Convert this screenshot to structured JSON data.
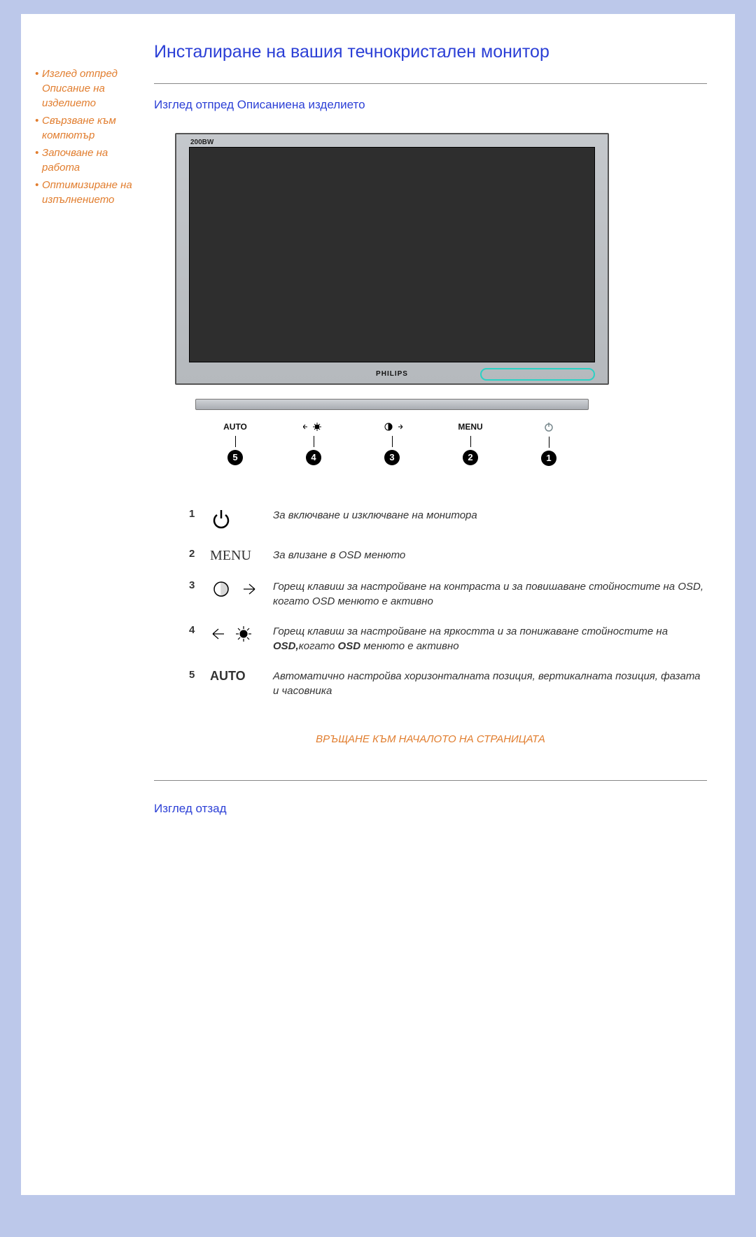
{
  "sidebar": {
    "items": [
      {
        "label": "Изглед отпред Описание на изделието"
      },
      {
        "label": "Свързване към компютър"
      },
      {
        "label": "Започване на работа"
      },
      {
        "label": "Оптимизиране на изпълнението"
      }
    ]
  },
  "page_title": "Инсталиране на вашия течнокристален   монитор",
  "front_heading": "Изглед отпред  Описаниена изделието",
  "monitor": {
    "model": "200BW",
    "brand": "PHILIPS"
  },
  "controls_strip": {
    "c5": "AUTO",
    "c2": "MENU",
    "badges": {
      "b1": "1",
      "b2": "2",
      "b3": "3",
      "b4": "4",
      "b5": "5"
    }
  },
  "legend": {
    "rows": [
      {
        "num": "1",
        "icon": "power",
        "text": "За включване и изключване на монитора"
      },
      {
        "num": "2",
        "icon": "menu",
        "text": "За влизане в OSD менюто"
      },
      {
        "num": "3",
        "icon": "contrast",
        "text": "Горещ клавиш за настройване на контраста и за повишаване стойностите на OSD, когато OSD менюто е активно"
      },
      {
        "num": "4",
        "icon": "brightness",
        "text_pre": "Горещ клавиш за настройване на яркостта и за понижаване стойностите на ",
        "text_b1": "OSD,",
        "text_mid": "когато ",
        "text_b2": "OSD",
        "text_post": " менюто е активно"
      },
      {
        "num": "5",
        "icon": "auto",
        "text": "Автоматично настройва хоризонталната позиция, вертикалната позиция, фазата и часовника"
      }
    ]
  },
  "return_link": "ВРЪЩАНЕ КЪМ НАЧАЛОТО НА СТРАНИЦАТА",
  "rear_heading": "Изглед отзад",
  "icon_labels": {
    "menu_word": "MENU",
    "auto_word": "AUTO"
  }
}
